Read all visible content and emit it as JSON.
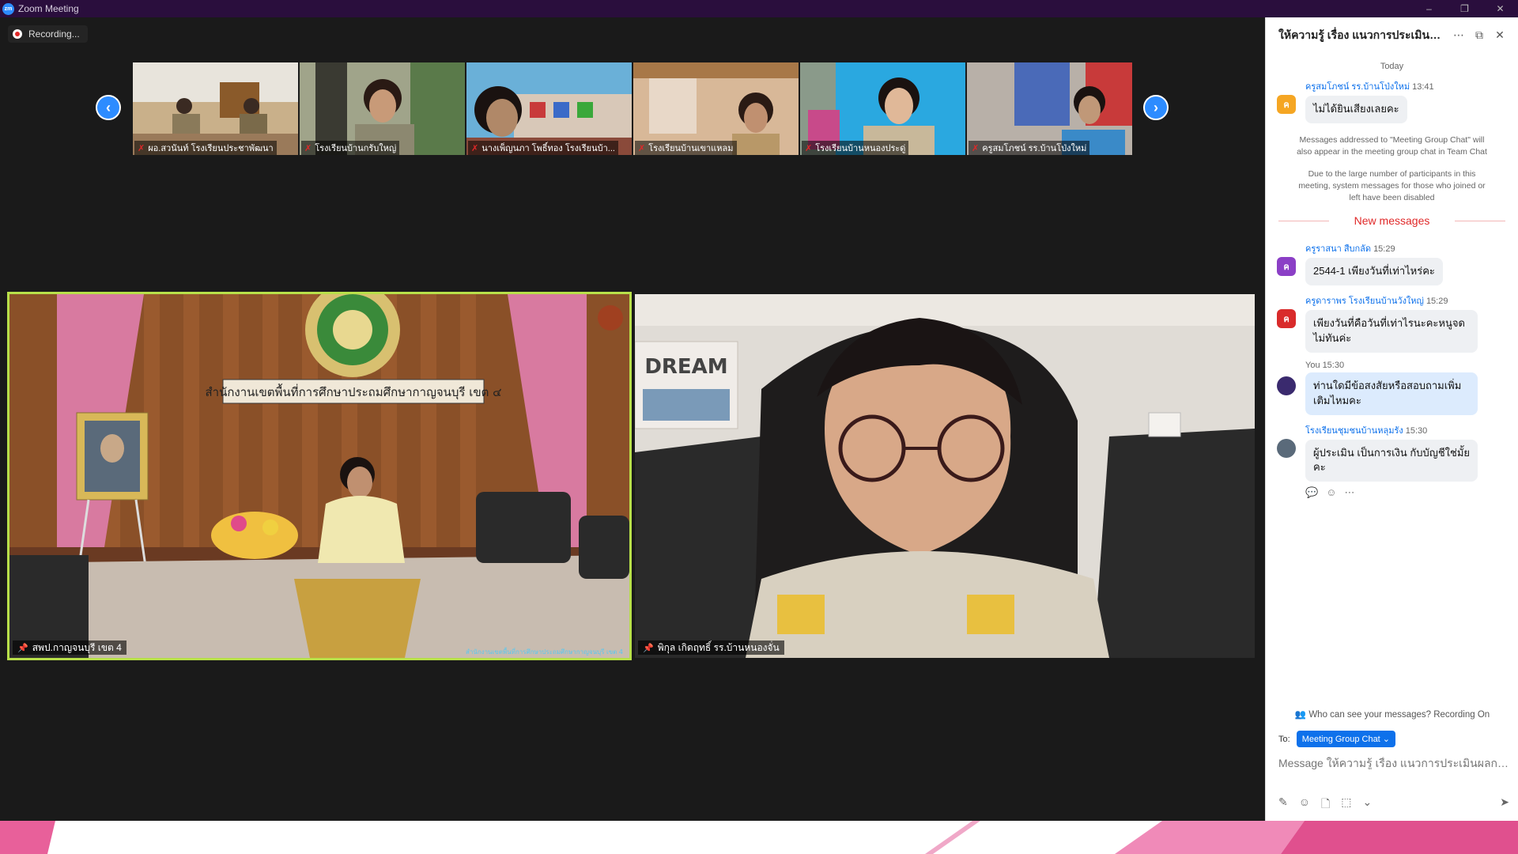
{
  "app": {
    "title": "Zoom Meeting",
    "logo_text": "zm"
  },
  "window_controls": {
    "minimize": "–",
    "restore": "❐",
    "close": "✕"
  },
  "recording": {
    "label": "Recording..."
  },
  "strip": {
    "prev_icon": "‹",
    "next_icon": "›",
    "thumbs": [
      {
        "label": "ผอ.สวนันท์ โรงเรียนประชาพัฒนา"
      },
      {
        "label": "โรงเรียนบ้านกรับใหญ่"
      },
      {
        "label": "นางเพ็ญนภา  โพธิ์ทอง  โรงเรียนบ้า..."
      },
      {
        "label": "โรงเรียนบ้านเขาแหลม"
      },
      {
        "label": "โรงเรียนบ้านหนองประดู่"
      },
      {
        "label": "ครูสมโภชน์ รร.บ้านโป่งใหม่"
      }
    ]
  },
  "main_video": {
    "label": "สพป.กาญจนบุรี เขต 4",
    "banner": "สำนักงานเขตพื้นที่การศึกษาประถมศึกษากาญจนบุรี เขต ๔",
    "watermark": "สำนักงานเขตพื้นที่การศึกษาประถมศึกษากาญจนบุรี เขต 4"
  },
  "right_video": {
    "label": "พิกุล  เกิดฤทธิ์ รร.บ้านหนองจั่น",
    "board_text": "DREAM"
  },
  "chat": {
    "title": "ให้ความรู้ เรื่อง แนวการประเมินผลก...",
    "date": "Today",
    "first": {
      "name": "ครูสมโภชน์ รร.บ้านโป่งใหม่",
      "time": "13:41",
      "text": "ไม่ได้ยินเสียงเลยคะ",
      "avatar": "ค",
      "color": "#f5a623"
    },
    "sys1": "Messages addressed to \"Meeting Group Chat\" will also appear in the meeting group chat in Team Chat",
    "sys2": "Due to the large number of participants in this meeting, system messages for those who joined or left have been disabled",
    "new_label": "New messages",
    "messages": [
      {
        "name": "ครูราสนา สืบกลัด",
        "time": "15:29",
        "text": "2544-1 เพียงวันที่เท่าไหร่คะ",
        "avatar": "ค",
        "color": "#8b3fc6"
      },
      {
        "name": "ครูดาราพร โรงเรียนบ้านวังใหญ่",
        "time": "15:29",
        "text": "เพียงวันที่คือวันที่เท่าไรนะคะหนูจดไม่ทันค่ะ",
        "avatar": "ค",
        "color": "#d92b2b"
      },
      {
        "name": "You",
        "time": "15:30",
        "text": "ท่านใดมีข้อสงสัยหรือสอบถามเพิ่มเติมไหมคะ",
        "avatar": "",
        "color": "#3a2a6e"
      },
      {
        "name": "โรงเรียนชุมชนบ้านหลุมรัง",
        "time": "15:30",
        "text": "ผู้ประเมิน เป็นการเงิน กับบัญชีใช่มั้ยคะ",
        "avatar": "",
        "color": "#5a6a7a"
      }
    ],
    "who_see": "Who can see your messages? Recording On",
    "to_label": "To:",
    "to_value": "Meeting Group Chat ⌄",
    "placeholder": "Message ให้ความรู้ เรื่อง แนวการประเมินผลการป..."
  }
}
